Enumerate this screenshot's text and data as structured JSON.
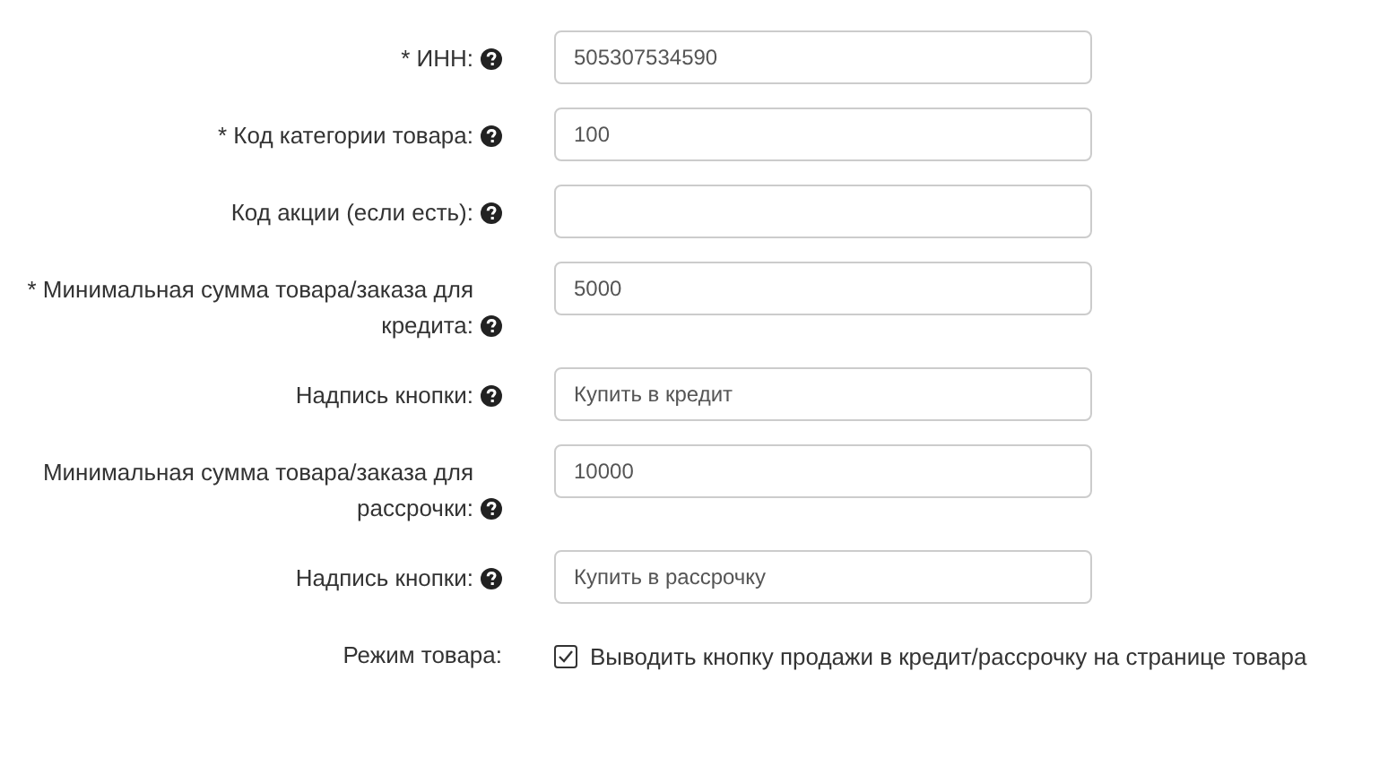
{
  "fields": [
    {
      "kind": "input",
      "label": "* ИНН:",
      "help": true,
      "value": "505307534590"
    },
    {
      "kind": "input",
      "label": "* Код категории товара:",
      "help": true,
      "value": "100"
    },
    {
      "kind": "input",
      "label": "Код акции (если есть):",
      "help": true
    },
    {
      "kind": "input",
      "label": "* Минимальная сумма товара/заказа для кредита:",
      "help": true,
      "value": "5000"
    },
    {
      "kind": "input",
      "label": "Надпись кнопки:",
      "help": true,
      "value": "Купить в кредит"
    },
    {
      "kind": "input",
      "label": "Минимальная сумма товара/заказа для рассрочки:",
      "help": true,
      "value": "10000"
    },
    {
      "kind": "input",
      "label": "Надпись кнопки:",
      "help": true,
      "value": "Купить в рассрочку"
    },
    {
      "kind": "checkbox",
      "label": "Режим товара:",
      "help": false,
      "option": "Выводить кнопку продажи в кредит/рассрочку на странице товара",
      "checked": true
    }
  ]
}
